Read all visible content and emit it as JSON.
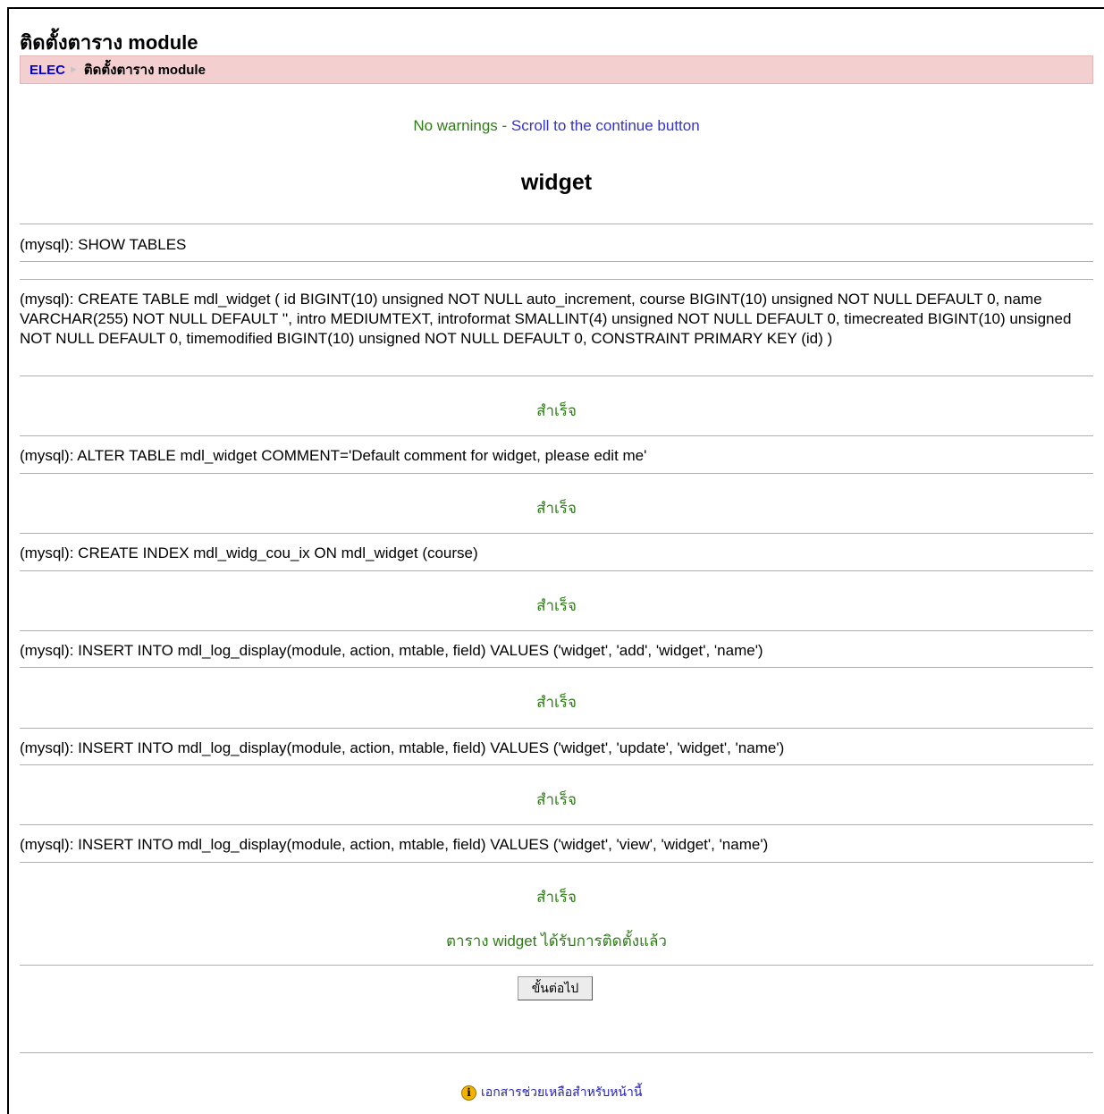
{
  "header": {
    "title": "ติดตั้งตาราง module",
    "breadcrumb": {
      "home": "ELEC",
      "separator": "►",
      "current": "ติดตั้งตาราง module"
    }
  },
  "notice": {
    "text": "No warnings - ",
    "link": "Scroll to the continue button"
  },
  "module_name": "widget",
  "queries": [
    {
      "sql": "(mysql): SHOW TABLES",
      "result": ""
    },
    {
      "sql": "(mysql): CREATE TABLE mdl_widget ( id BIGINT(10) unsigned NOT NULL auto_increment, course BIGINT(10) unsigned NOT NULL DEFAULT 0, name VARCHAR(255) NOT NULL DEFAULT '', intro MEDIUMTEXT, introformat SMALLINT(4) unsigned NOT NULL DEFAULT 0, timecreated BIGINT(10) unsigned NOT NULL DEFAULT 0, timemodified BIGINT(10) unsigned NOT NULL DEFAULT 0, CONSTRAINT PRIMARY KEY (id) )",
      "result": "สำเร็จ"
    },
    {
      "sql": "(mysql): ALTER TABLE mdl_widget COMMENT='Default comment for widget, please edit me'",
      "result": "สำเร็จ"
    },
    {
      "sql": "(mysql): CREATE INDEX mdl_widg_cou_ix ON mdl_widget (course)",
      "result": "สำเร็จ"
    },
    {
      "sql": "(mysql): INSERT INTO mdl_log_display(module, action, mtable, field) VALUES ('widget', 'add', 'widget', 'name')",
      "result": "สำเร็จ"
    },
    {
      "sql": "(mysql): INSERT INTO mdl_log_display(module, action, mtable, field) VALUES ('widget', 'update', 'widget', 'name')",
      "result": "สำเร็จ"
    },
    {
      "sql": "(mysql): INSERT INTO mdl_log_display(module, action, mtable, field) VALUES ('widget', 'view', 'widget', 'name')",
      "result": "สำเร็จ"
    }
  ],
  "installed_message": "ตาราง widget ได้รับการติดตั้งแล้ว",
  "continue_button": "ขั้นต่อไป",
  "help_link": "เอกสารช่วยเหลือสำหรับหน้านี้",
  "colors": {
    "success": "#2e7d16",
    "link": "#3333cc",
    "navbar_bg": "#f3cfcf"
  }
}
